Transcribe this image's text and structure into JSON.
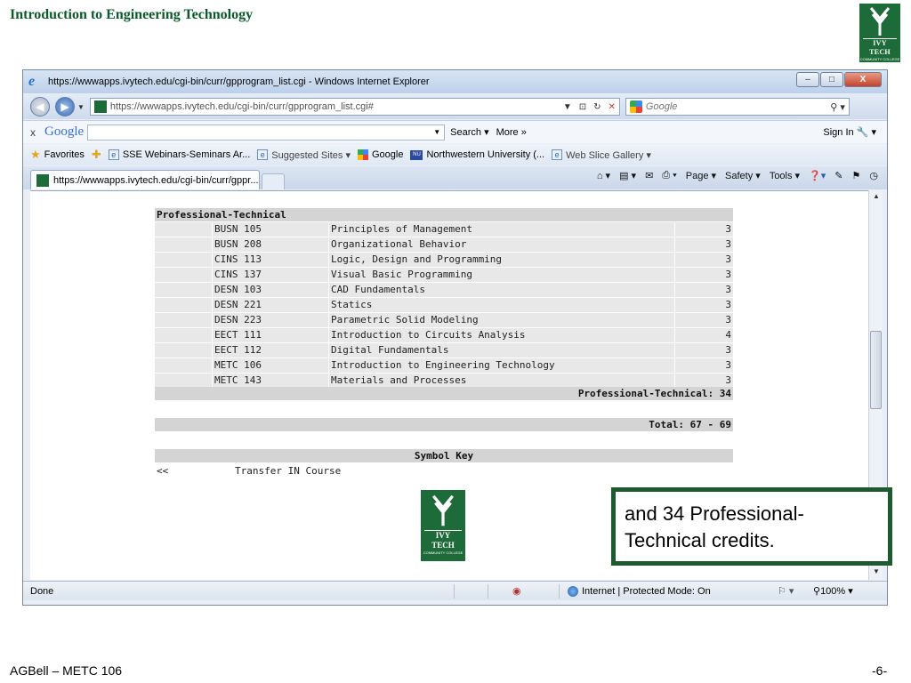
{
  "slide": {
    "title": "Introduction to Engineering Technology",
    "footer_left": "AGBell – METC 106",
    "footer_right": "-6-",
    "logo_text": "IVY TECH",
    "logo_sub": "COMMUNITY COLLEGE"
  },
  "window": {
    "title": "https://wwwapps.ivytech.edu/cgi-bin/curr/gpprogram_list.cgi - Windows Internet Explorer",
    "address": "https://wwwapps.ivytech.edu/cgi-bin/curr/gpprogram_list.cgi#",
    "search_placeholder": "Google",
    "min_label": "–",
    "max_label": "□",
    "close_label": "X"
  },
  "googlebar": {
    "close": "x",
    "logo": "Google",
    "search_label": "Search ▾",
    "more_label": "More »",
    "signin_label": "Sign In"
  },
  "favorites": {
    "favorites_label": "Favorites",
    "items": [
      "SSE Webinars-Seminars Ar...",
      "Suggested Sites ▾",
      "Google",
      "Northwestern University (...",
      "Web Slice Gallery ▾"
    ]
  },
  "tab": {
    "label": "https://wwwapps.ivytech.edu/cgi-bin/curr/gppr..."
  },
  "commands": [
    "Page ▾",
    "Safety ▾",
    "Tools ▾"
  ],
  "program": {
    "section": "Professional-Technical",
    "courses": [
      {
        "code": "BUSN 105",
        "title": "Principles of Management",
        "credits": "3"
      },
      {
        "code": "BUSN 208",
        "title": "Organizational Behavior",
        "credits": "3"
      },
      {
        "code": "CINS 113",
        "title": "Logic, Design and Programming",
        "credits": "3"
      },
      {
        "code": "CINS 137",
        "title": "Visual Basic Programming",
        "credits": "3"
      },
      {
        "code": "DESN 103",
        "title": "CAD Fundamentals",
        "credits": "3"
      },
      {
        "code": "DESN 221",
        "title": "Statics",
        "credits": "3"
      },
      {
        "code": "DESN 223",
        "title": "Parametric Solid Modeling",
        "credits": "3"
      },
      {
        "code": "EECT 111",
        "title": "Introduction to Circuits Analysis",
        "credits": "4"
      },
      {
        "code": "EECT 112",
        "title": "Digital Fundamentals",
        "credits": "3"
      },
      {
        "code": "METC 106",
        "title": "Introduction to Engineering Technology",
        "credits": "3"
      },
      {
        "code": "METC 143",
        "title": "Materials and Processes",
        "credits": "3"
      }
    ],
    "subtotal": "Professional-Technical: 34",
    "total": "Total: 67 - 69",
    "symbol_key_title": "Symbol Key",
    "symbol": "<<",
    "symbol_meaning": "Transfer IN Course"
  },
  "status": {
    "done": "Done",
    "zone": "Internet | Protected Mode: On",
    "zoom": "100%"
  },
  "callout": {
    "text": "and 34 Professional-Technical credits."
  },
  "colors": {
    "ivy_green": "#1e6b3a",
    "title_green": "#0b5a2b",
    "callout_border": "#1e5a30",
    "table_header": "#d4d4d4",
    "table_row": "#e8e8e8"
  }
}
